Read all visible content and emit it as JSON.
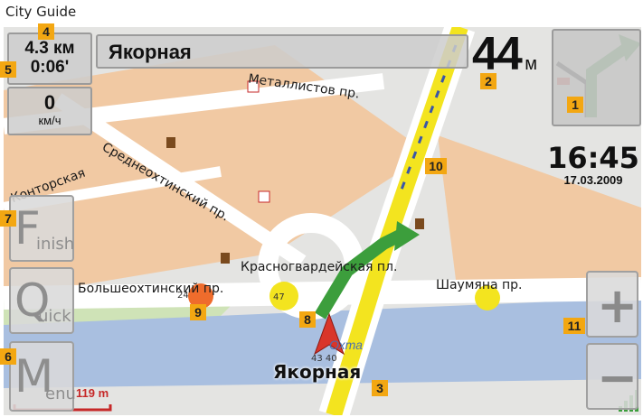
{
  "app": {
    "title": "City Guide"
  },
  "navigation": {
    "distance_remaining": "4.3 км",
    "time_remaining": "0:06'",
    "speed_value": "0",
    "speed_unit": "км/ч",
    "current_street": "Якорная",
    "turn_distance_value": "44",
    "turn_distance_unit": "м",
    "clock_time": "16:45",
    "clock_date": "17.03.2009",
    "scale_label": "119 m",
    "footer_street": "Якорная"
  },
  "buttons": {
    "finish_big": "F",
    "finish_small": "inish",
    "quick_big": "Q",
    "quick_small": "uick",
    "menu_big": "M",
    "menu_small": "enu",
    "zoom_in": "+",
    "zoom_out": "−"
  },
  "map_labels": {
    "metallistov": "Металлистов пр.",
    "sredneokhtinsky": "Среднеохтинский пр.",
    "kontorskaya": "Конторская",
    "krasnogvardeyskaya": "Красногвардейская пл.",
    "bolsheokhtinsky": "Большеохтинский пр.",
    "shaumyana": "Шаумяна пр.",
    "river": "Охта",
    "house_24": "24",
    "house_47": "47",
    "house_43": "43 40"
  },
  "callouts": [
    "1",
    "2",
    "3",
    "4",
    "5",
    "6",
    "7",
    "8",
    "9",
    "10",
    "11"
  ],
  "colors": {
    "route": "#f3e41f",
    "arrow": "#3c9e3c",
    "position": "#d9352a",
    "badge": "#f3a712",
    "land": "#f1c9a3",
    "water": "#a9bfe0"
  }
}
